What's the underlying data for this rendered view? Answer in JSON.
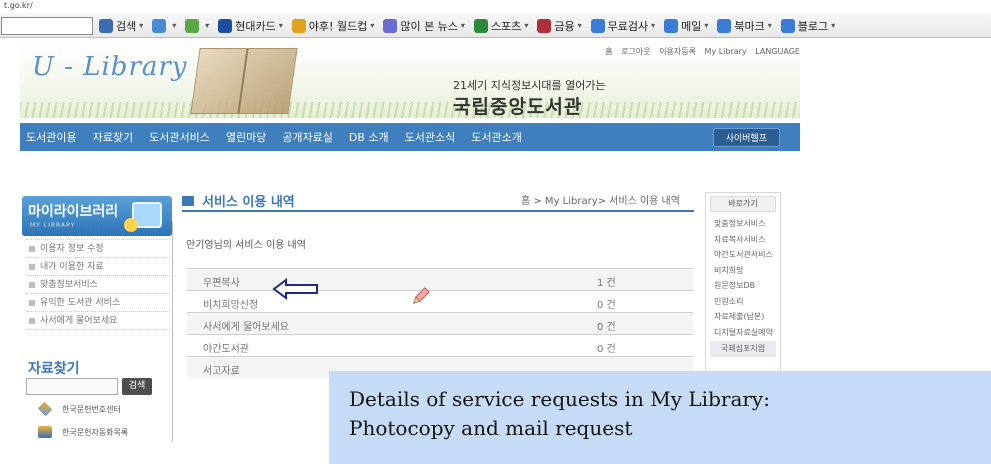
{
  "browser": {
    "url_fragment": "t.go.kr/",
    "toolbar_items": [
      {
        "label": "검색",
        "icon": "search-icon",
        "color": "#3d6bb3"
      },
      {
        "label": "",
        "icon": "bookmark-icon",
        "color": "#4a8ad0"
      },
      {
        "label": "",
        "icon": "paint-icon",
        "color": "#5aa845"
      },
      {
        "label": "현대카드",
        "icon": "card-icon",
        "color": "#1f4e9e"
      },
      {
        "label": "야후! 월드컵",
        "icon": "soccer-icon",
        "color": "#e0a320"
      },
      {
        "label": "많이 본 뉴스",
        "icon": "news-icon",
        "color": "#6b6bd1"
      },
      {
        "label": "스포츠",
        "icon": "sports-icon",
        "color": "#2d8a3b"
      },
      {
        "label": "금융",
        "icon": "finance-icon",
        "color": "#b0303a"
      },
      {
        "label": "무료검사",
        "icon": "shield-icon",
        "color": "#3a7bd5"
      },
      {
        "label": "메일",
        "icon": "mail-icon",
        "color": "#3a7bd5"
      },
      {
        "label": "북마크",
        "icon": "bookmark-star-icon",
        "color": "#3a7bd5"
      },
      {
        "label": "블로그",
        "icon": "blog-icon",
        "color": "#3a7bd5"
      }
    ]
  },
  "header": {
    "logo": "U - Library",
    "tagline": "21세기 지식정보시대를 열어가는",
    "library_name": "국립중앙도서관",
    "util_links": [
      "홈",
      "로그아웃",
      "이용자등록",
      "My Library",
      "LANGUAGE"
    ],
    "nav": [
      "도서관이용",
      "자료찾기",
      "도서관서비스",
      "열린마당",
      "공개자료실",
      "DB 소개",
      "도서관소식",
      "도서관소개"
    ],
    "appointment_button": "사이버헬프"
  },
  "sidebar": {
    "title": "마이라이브러리",
    "subtitle": "MY LIBRARY",
    "menu": [
      {
        "label": "서비스 이용 내역",
        "active": true
      },
      {
        "label": "이용자 정보 수정",
        "active": false
      },
      {
        "label": "내가 이용한 자료",
        "active": false
      },
      {
        "label": "맞춤정보서비스",
        "active": false
      },
      {
        "label": "유익한 도서관 서비스",
        "active": false
      },
      {
        "label": "사서에게 물어보세요",
        "active": false
      }
    ],
    "search_title": "자료찾기",
    "search_button": "검색",
    "sponsors": [
      "한국문헌번호센터",
      "한국문헌자동화목록"
    ]
  },
  "main": {
    "page_title": "서비스 이용 내역",
    "breadcrumb": "홈 > My Library> 서비스 이용 내역",
    "greeting": "안기영님의 서비스 이용 내역",
    "services": [
      {
        "name": "우편복사",
        "count": "1 건"
      },
      {
        "name": "비치희망신청",
        "count": "0 건"
      },
      {
        "name": "사서에게 물어보세요",
        "count": "0 건"
      },
      {
        "name": "야간도서관",
        "count": "0 건"
      },
      {
        "name": "서고자료",
        "count": ""
      }
    ]
  },
  "right_panel": {
    "header": "바로가기",
    "links": [
      "맞춤정보서비스",
      "자료복사서비스",
      "야간도서관서비스",
      "비치희망",
      "원문정보DB",
      "민원소리",
      "자료제출(납본)",
      "디지털자료실예약"
    ],
    "highlighted": "국제심포지엄"
  },
  "annotation": {
    "line1": "Details of service requests in My Library:",
    "line2": "Photocopy and mail request",
    "color": "#c6dcf6"
  }
}
